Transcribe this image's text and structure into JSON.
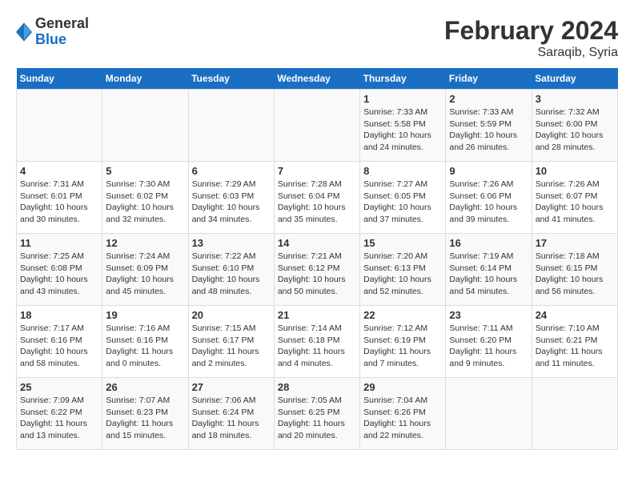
{
  "header": {
    "logo_general": "General",
    "logo_blue": "Blue",
    "title": "February 2024",
    "subtitle": "Saraqib, Syria"
  },
  "days_of_week": [
    "Sunday",
    "Monday",
    "Tuesday",
    "Wednesday",
    "Thursday",
    "Friday",
    "Saturday"
  ],
  "weeks": [
    [
      {
        "day": "",
        "info": ""
      },
      {
        "day": "",
        "info": ""
      },
      {
        "day": "",
        "info": ""
      },
      {
        "day": "",
        "info": ""
      },
      {
        "day": "1",
        "info": "Sunrise: 7:33 AM\nSunset: 5:58 PM\nDaylight: 10 hours and 24 minutes."
      },
      {
        "day": "2",
        "info": "Sunrise: 7:33 AM\nSunset: 5:59 PM\nDaylight: 10 hours and 26 minutes."
      },
      {
        "day": "3",
        "info": "Sunrise: 7:32 AM\nSunset: 6:00 PM\nDaylight: 10 hours and 28 minutes."
      }
    ],
    [
      {
        "day": "4",
        "info": "Sunrise: 7:31 AM\nSunset: 6:01 PM\nDaylight: 10 hours and 30 minutes."
      },
      {
        "day": "5",
        "info": "Sunrise: 7:30 AM\nSunset: 6:02 PM\nDaylight: 10 hours and 32 minutes."
      },
      {
        "day": "6",
        "info": "Sunrise: 7:29 AM\nSunset: 6:03 PM\nDaylight: 10 hours and 34 minutes."
      },
      {
        "day": "7",
        "info": "Sunrise: 7:28 AM\nSunset: 6:04 PM\nDaylight: 10 hours and 35 minutes."
      },
      {
        "day": "8",
        "info": "Sunrise: 7:27 AM\nSunset: 6:05 PM\nDaylight: 10 hours and 37 minutes."
      },
      {
        "day": "9",
        "info": "Sunrise: 7:26 AM\nSunset: 6:06 PM\nDaylight: 10 hours and 39 minutes."
      },
      {
        "day": "10",
        "info": "Sunrise: 7:26 AM\nSunset: 6:07 PM\nDaylight: 10 hours and 41 minutes."
      }
    ],
    [
      {
        "day": "11",
        "info": "Sunrise: 7:25 AM\nSunset: 6:08 PM\nDaylight: 10 hours and 43 minutes."
      },
      {
        "day": "12",
        "info": "Sunrise: 7:24 AM\nSunset: 6:09 PM\nDaylight: 10 hours and 45 minutes."
      },
      {
        "day": "13",
        "info": "Sunrise: 7:22 AM\nSunset: 6:10 PM\nDaylight: 10 hours and 48 minutes."
      },
      {
        "day": "14",
        "info": "Sunrise: 7:21 AM\nSunset: 6:12 PM\nDaylight: 10 hours and 50 minutes."
      },
      {
        "day": "15",
        "info": "Sunrise: 7:20 AM\nSunset: 6:13 PM\nDaylight: 10 hours and 52 minutes."
      },
      {
        "day": "16",
        "info": "Sunrise: 7:19 AM\nSunset: 6:14 PM\nDaylight: 10 hours and 54 minutes."
      },
      {
        "day": "17",
        "info": "Sunrise: 7:18 AM\nSunset: 6:15 PM\nDaylight: 10 hours and 56 minutes."
      }
    ],
    [
      {
        "day": "18",
        "info": "Sunrise: 7:17 AM\nSunset: 6:16 PM\nDaylight: 10 hours and 58 minutes."
      },
      {
        "day": "19",
        "info": "Sunrise: 7:16 AM\nSunset: 6:16 PM\nDaylight: 11 hours and 0 minutes."
      },
      {
        "day": "20",
        "info": "Sunrise: 7:15 AM\nSunset: 6:17 PM\nDaylight: 11 hours and 2 minutes."
      },
      {
        "day": "21",
        "info": "Sunrise: 7:14 AM\nSunset: 6:18 PM\nDaylight: 11 hours and 4 minutes."
      },
      {
        "day": "22",
        "info": "Sunrise: 7:12 AM\nSunset: 6:19 PM\nDaylight: 11 hours and 7 minutes."
      },
      {
        "day": "23",
        "info": "Sunrise: 7:11 AM\nSunset: 6:20 PM\nDaylight: 11 hours and 9 minutes."
      },
      {
        "day": "24",
        "info": "Sunrise: 7:10 AM\nSunset: 6:21 PM\nDaylight: 11 hours and 11 minutes."
      }
    ],
    [
      {
        "day": "25",
        "info": "Sunrise: 7:09 AM\nSunset: 6:22 PM\nDaylight: 11 hours and 13 minutes."
      },
      {
        "day": "26",
        "info": "Sunrise: 7:07 AM\nSunset: 6:23 PM\nDaylight: 11 hours and 15 minutes."
      },
      {
        "day": "27",
        "info": "Sunrise: 7:06 AM\nSunset: 6:24 PM\nDaylight: 11 hours and 18 minutes."
      },
      {
        "day": "28",
        "info": "Sunrise: 7:05 AM\nSunset: 6:25 PM\nDaylight: 11 hours and 20 minutes."
      },
      {
        "day": "29",
        "info": "Sunrise: 7:04 AM\nSunset: 6:26 PM\nDaylight: 11 hours and 22 minutes."
      },
      {
        "day": "",
        "info": ""
      },
      {
        "day": "",
        "info": ""
      }
    ]
  ]
}
